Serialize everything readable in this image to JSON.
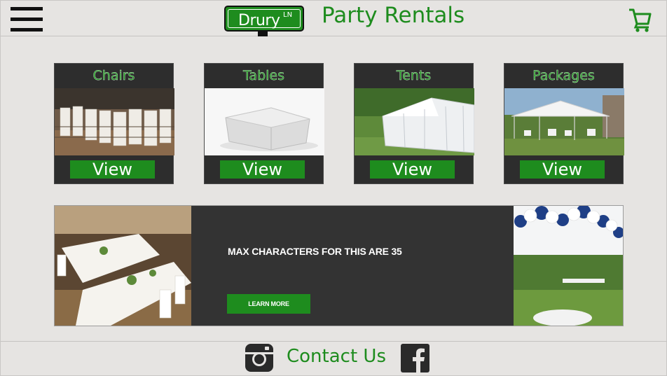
{
  "header": {
    "logo_text": "Drury",
    "logo_sup": "LN",
    "title": "Party Rentals",
    "menu_icon": "hamburger-menu-icon",
    "cart_icon": "shopping-cart-icon"
  },
  "categories": [
    {
      "title": "Chairs",
      "button": "View"
    },
    {
      "title": "Tables",
      "button": "View"
    },
    {
      "title": "Tents",
      "button": "View"
    },
    {
      "title": "Packages",
      "button": "View"
    }
  ],
  "banner": {
    "headline": "MAX CHARACTERS FOR THIS ARE 35",
    "button": "LEARN MORE"
  },
  "footer": {
    "contact": "Contact Us",
    "instagram_icon": "instagram-icon",
    "facebook_icon": "facebook-icon"
  },
  "colors": {
    "brand_green": "#1e8c1e",
    "card_bg": "#2d2d2d",
    "page_bg": "#e6e4e2"
  }
}
